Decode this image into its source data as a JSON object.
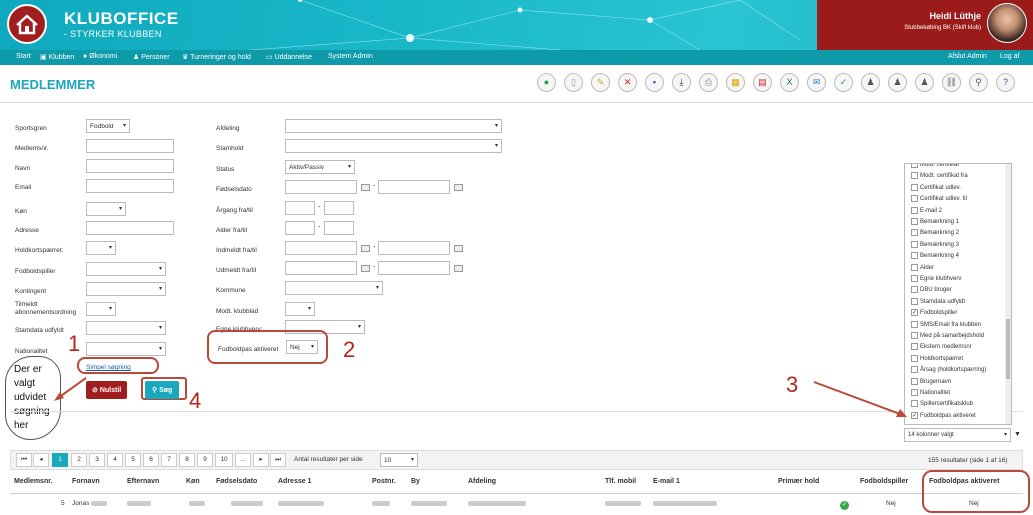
{
  "header": {
    "brand": "KLUBOFFICE",
    "tagline": "- STYRKER KLUBBEN",
    "user_name": "Heidi Lüthje",
    "user_club": "Stubbekøbing BK (Skift klub)"
  },
  "nav": {
    "items": [
      "Start",
      "Klubben",
      "Økonomi",
      "Personer",
      "Turneringer og hold",
      "Uddannelse",
      "System Admin"
    ],
    "logout_admin": "Afslut Admin",
    "logout": "Log af"
  },
  "page": {
    "title": "MEDLEMMER"
  },
  "form": {
    "sportsgren": "Sportsgren",
    "sportsgren_val": "Fodbold",
    "medlemsnr": "Medlemsnr.",
    "navn": "Navn",
    "email": "Email",
    "kon": "Køn",
    "adresse": "Adresse",
    "holdkort": "Holdkortspærret:",
    "fodboldspiller": "Fodboldspiller",
    "kontingent": "Kontingent",
    "tilmeldt": "Tilmeldt",
    "abonnement": "abonnementsordning",
    "standata": "Stamdata udfyldt",
    "nationalitet": "Nationalitet",
    "afdeling": "Afdeling",
    "stamhold": "Stamhold",
    "status": "Status",
    "status_val": "Aktiv/Passiv",
    "fodselsdato": "Fødselsdato",
    "argang": "Årgang fra/til",
    "alder": "Alder fra/til",
    "indmeldt": "Indmeldt fra/til",
    "udmeldt": "Udmeldt fra/til",
    "kommune": "Kommune",
    "modt_klubblad": "Modt. klubblad",
    "egne_klubhverv": "Egne klubhverv:",
    "fodboldpas": "Fodboldpas aktiveret",
    "fodboldpas_val": "Nej",
    "simpel": "Simpel søgning",
    "nulstil": "Nulstil",
    "sog": "Søg"
  },
  "annotation": {
    "n1": "1",
    "n2": "2",
    "n3": "3",
    "n4": "4",
    "text": [
      "Der er",
      "valgt",
      "udvidet",
      "søgning",
      "her"
    ]
  },
  "columns": {
    "items": [
      {
        "label": "Modt. certifikat",
        "checked": false
      },
      {
        "label": "Modt. certifikat fra",
        "checked": false
      },
      {
        "label": "Certifikat udlev.",
        "checked": false
      },
      {
        "label": "Certifikat udlev. til",
        "checked": false
      },
      {
        "label": "E-mail 2",
        "checked": false
      },
      {
        "label": "Bemærkning 1",
        "checked": false
      },
      {
        "label": "Bemærkning 2",
        "checked": false
      },
      {
        "label": "Bemærkning 3",
        "checked": false
      },
      {
        "label": "Bemærkning 4",
        "checked": false
      },
      {
        "label": "Alder",
        "checked": false
      },
      {
        "label": "Egne klubhverv",
        "checked": false
      },
      {
        "label": "DBU bruger",
        "checked": false
      },
      {
        "label": "Stamdata udfyldt",
        "checked": false
      },
      {
        "label": "Fodboldspiller",
        "checked": true
      },
      {
        "label": "SMS/Email fra klubben",
        "checked": false
      },
      {
        "label": "Med på samarbejdshold",
        "checked": false
      },
      {
        "label": "Ekstern medlemsnr",
        "checked": false
      },
      {
        "label": "Holdkortspærret",
        "checked": false
      },
      {
        "label": "Årsag (holdkortspærring)",
        "checked": false
      },
      {
        "label": "Brugernavn",
        "checked": false
      },
      {
        "label": "Nationalitet",
        "checked": false
      },
      {
        "label": "Spillercertifikatsklub",
        "checked": false
      },
      {
        "label": "Fodboldpas aktiveret",
        "checked": true
      }
    ],
    "selected": "14 kolonner valgt"
  },
  "pager": {
    "pages": [
      "1",
      "2",
      "3",
      "4",
      "5",
      "6",
      "7",
      "8",
      "9",
      "10",
      "..."
    ],
    "per_page_label": "Antal resultater per side",
    "per_page": "10",
    "results": "155 resultater (side 1 af 16)"
  },
  "table": {
    "headers": [
      "Medlemsnr.",
      "Fornavn",
      "Efternavn",
      "Køn",
      "Fødselsdato",
      "Adresse 1",
      "Postnr.",
      "By",
      "Afdeling",
      "Tlf. mobil",
      "E-mail 1",
      "Primær hold",
      "Fodboldspiller",
      "Fodboldpas aktiveret"
    ],
    "row": {
      "nr": "5",
      "fornavn": "Jonas",
      "spiller": "Nej",
      "pas": "Nej"
    }
  },
  "colors": {
    "accent": "#1aa8bc",
    "brand_red": "#a01e1e",
    "annotation": "#b94a3a"
  }
}
